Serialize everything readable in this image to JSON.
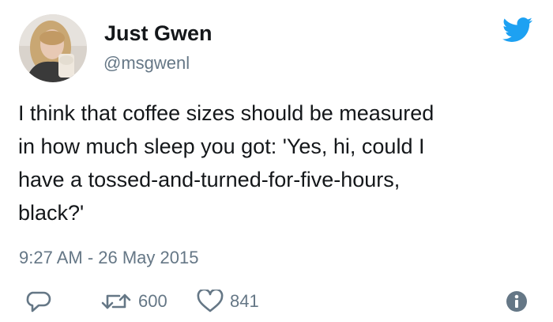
{
  "user": {
    "display_name": "Just Gwen",
    "handle": "@msgwenl"
  },
  "tweet": {
    "text": "I think that coffee sizes should be measured\nin how much sleep you got: 'Yes, hi, could I\nhave a tossed-and-turned-for-five-hours,\nblack?'",
    "timestamp": "9:27 AM - 26 May 2015"
  },
  "actions": {
    "reply_icon": "reply-icon",
    "retweet_icon": "retweet-icon",
    "retweet_count": "600",
    "like_icon": "heart-icon",
    "like_count": "841",
    "info_icon": "info-icon"
  },
  "colors": {
    "brand": "#1da1f2",
    "text": "#14171a",
    "secondary": "#657786"
  }
}
